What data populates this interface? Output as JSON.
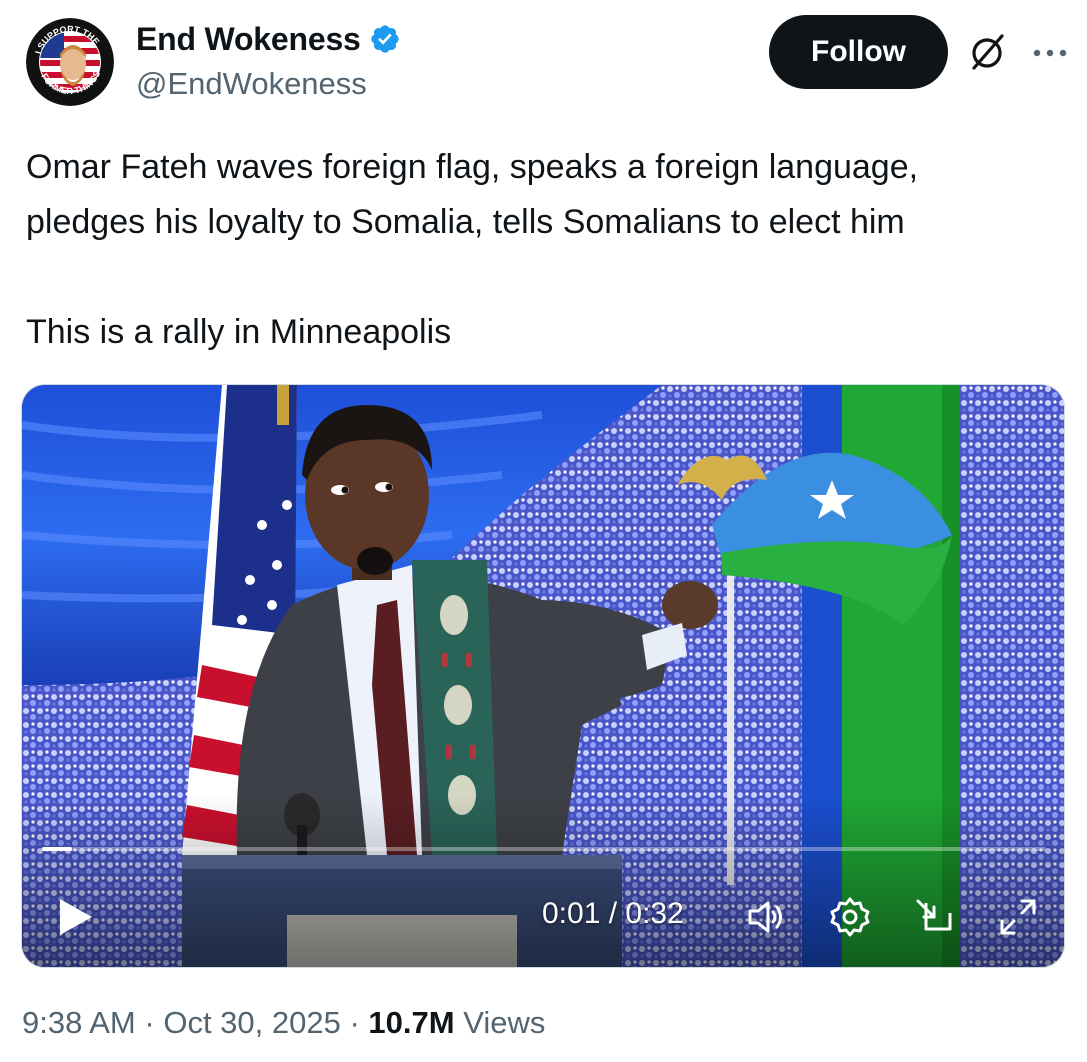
{
  "author": {
    "display_name": "End Wokeness",
    "handle": "@EndWokeness",
    "verified": true,
    "avatar_icon": "avatar-badge",
    "avatar_text_top": "I SUPPORT THE",
    "avatar_text_bottom": "FORMER THINGS"
  },
  "actions": {
    "follow_label": "Follow",
    "grok_icon": "grok-icon",
    "more_icon": "more-icon"
  },
  "tweet": {
    "lines": [
      "Omar Fateh waves foreign flag, speaks a foreign language,",
      "pledges his loyalty to Somalia, tells Somalians to elect him"
    ],
    "second_paragraph": "This is a rally in Minneapolis"
  },
  "video": {
    "current_time": "0:01",
    "duration": "0:32",
    "time_display": "0:01 / 0:32",
    "progress": 0.03,
    "controls": [
      "play-icon",
      "volume-icon",
      "settings-icon",
      "pip-icon",
      "fullscreen-icon"
    ]
  },
  "meta": {
    "time": "9:38 AM",
    "date": "Oct 30, 2025",
    "views_count": "10.7M",
    "views_label": "Views",
    "separator": "·"
  },
  "colors": {
    "text_primary": "#0f1419",
    "text_secondary": "#536471",
    "verified_blue": "#1d9bf0",
    "follow_bg": "#0f1419"
  }
}
